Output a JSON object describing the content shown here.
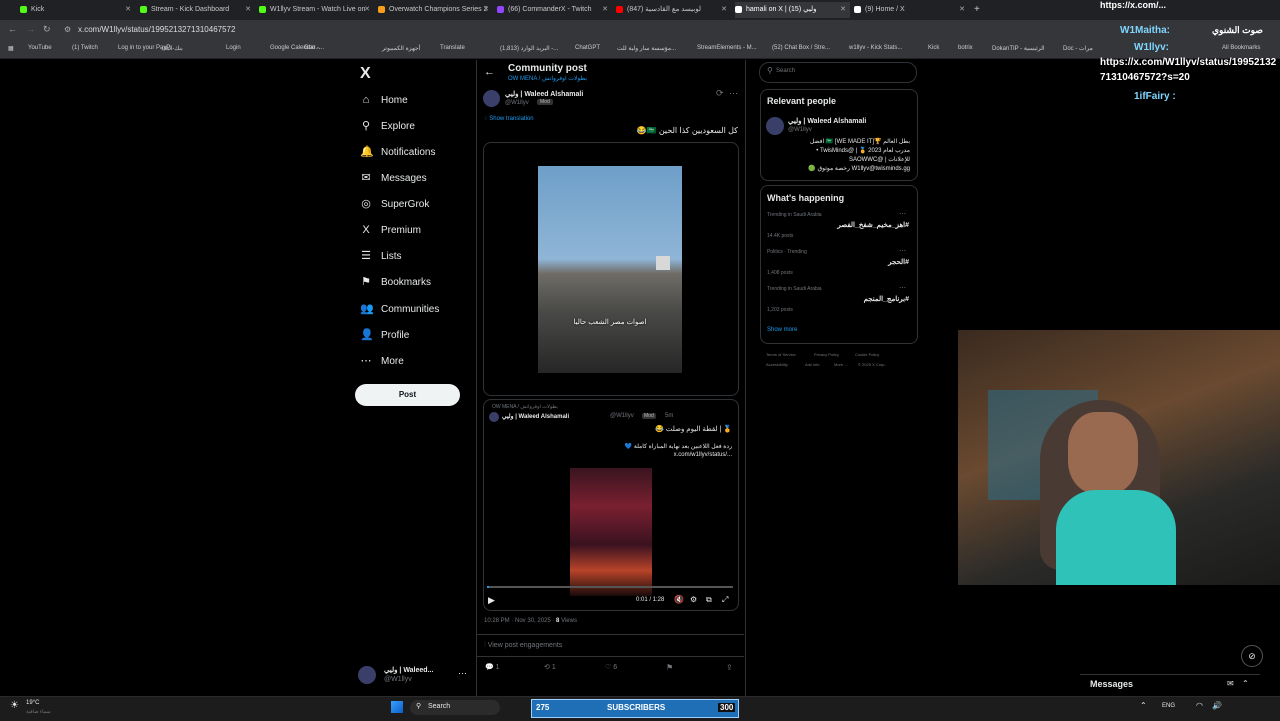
{
  "browser": {
    "tabs": [
      {
        "label": "Kick",
        "color": "#53fc18"
      },
      {
        "label": "Stream - Kick Dashboard",
        "color": "#53fc18"
      },
      {
        "label": "W1llyv Stream - Watch Live on",
        "color": "#53fc18"
      },
      {
        "label": "Overwatch Champions Series 2",
        "color": "#f99e1a"
      },
      {
        "label": "(66) CommanderX - Twitch",
        "color": "#9146ff"
      },
      {
        "label": "(847) لوبيسد مع القادسية",
        "color": "#ff0000"
      },
      {
        "label": "hamali on X | وليي (15)",
        "color": "#ffffff"
      },
      {
        "label": "(9) Home / X",
        "color": "#ffffff"
      }
    ],
    "url": "x.com/W1llyv/status/1995213271310467572",
    "bookmarks": [
      "YouTube",
      "(1) Twitch",
      "Log in to your PayP...",
      "بنك البلاد",
      "Login",
      "Google Calendar -...",
      "Goo...",
      "أجهزة الكمبيوتر",
      "Translate",
      "(1,813) البريد الوارد -...",
      "ChatGPT",
      "مؤسسة سار ولية للت...",
      "StreamElements - M...",
      "(52) Chat Box / Stre...",
      "w1llyv - Kick Stats...",
      "Kick",
      "botrix",
      "DokanTIP - الرئيسية",
      "Doc - مرات",
      "All Bookmarks"
    ]
  },
  "nav": {
    "logo": "X",
    "items": [
      {
        "label": "Home",
        "icon": "⌂"
      },
      {
        "label": "Explore",
        "icon": "⚲"
      },
      {
        "label": "Notifications",
        "icon": "🔔"
      },
      {
        "label": "Messages",
        "icon": "✉"
      },
      {
        "label": "SuperGrok",
        "icon": "◎"
      },
      {
        "label": "Premium",
        "icon": "X"
      },
      {
        "label": "Lists",
        "icon": "☰"
      },
      {
        "label": "Bookmarks",
        "icon": "⚑"
      },
      {
        "label": "Communities",
        "icon": "👥"
      },
      {
        "label": "Profile",
        "icon": "👤"
      },
      {
        "label": "More",
        "icon": "⋯"
      }
    ],
    "post_label": "Post",
    "account": {
      "name": "وليي | Waleed...",
      "handle": "@W1llyv"
    }
  },
  "post": {
    "header_title": "Community post",
    "header_sub": "OW MENA / بطولات اوفرواتش",
    "author_name": "وليي | Waleed Alshamali",
    "author_handle": "@W1llyv",
    "mod_badge": "Mod",
    "show_translation": "Show translation",
    "text": "كل السعوديين كذا الحين 🇸🇦😂",
    "video_caption": "اصوات مصر الشعب حاليا",
    "quote": {
      "community": "OW MENA / بطولات اوفرواتش",
      "author_name": "وليي | Waleed Alshamali",
      "author_handle": "@W1llyv",
      "mod_badge": "Mod",
      "time": "5m",
      "line1": "🏅 | لقطة اليوم وصلت 😂",
      "line2": "ردة فعل اللاعبين بعد نهاية المباراة كاملة 💙",
      "line3": "x.com/w1llyv/status/...",
      "player_time": "0:01 / 1:28"
    },
    "timestamp": "10:28 PM · Nov 30, 2025 · ",
    "views_count": "8",
    "views_label": "Views",
    "engagements": "View post engagements",
    "replies": "1",
    "reposts": "1",
    "likes": "6"
  },
  "right": {
    "search_placeholder": "Search",
    "relevant_title": "Relevant people",
    "person": {
      "name": "وليي | Waleed Alshamali",
      "handle": "@W1llyv",
      "bio1": "بطل العالم 🏆🇸🇦 [WE MADE IT] افضل",
      "bio2": "مدرب لعام 2023 🏅 | @TwisMinds •",
      "bio3": "للإعلانات | @SAOWWC",
      "bio4": "W1llyv@twisminds.gg رخصة موثوق 🟢"
    },
    "happening_title": "What's happening",
    "trends": [
      {
        "context": "Trending in Saudi Arabia",
        "name": "#اهز_مخيم_شفخ_الفصر",
        "count": "14.4K posts"
      },
      {
        "context": "Politics · Trending",
        "name": "#الحجر",
        "count": "1,408 posts"
      },
      {
        "context": "Trending in Saudi Arabia",
        "name": "#برنامج_المنجم",
        "count": "1,203 posts"
      }
    ],
    "show_more": "Show more",
    "footer": [
      "Terms of Service",
      "Privacy Policy",
      "Cookie Policy",
      "Accessibility",
      "Ads info",
      "More ...",
      "© 2025 X Corp."
    ]
  },
  "stream_overlay": {
    "line1": "https://x.com/...",
    "user1": "W1Maitha:",
    "text1": "صوت الشنوي",
    "user2": "W1llyv:",
    "url_line": "https://x.com/W1llyv/status/19952132",
    "url_line2": "71310467572?s=20",
    "user3": "1ifFairy :",
    "subscribers_count": "275",
    "subscribers_label": "SUBSCRIBERS",
    "subscribers_goal": "300"
  },
  "messages_label": "Messages",
  "taskbar": {
    "weather_temp": "19°C",
    "weather_desc": "سماء صافية",
    "search_label": "Search",
    "lang": "ENG"
  }
}
